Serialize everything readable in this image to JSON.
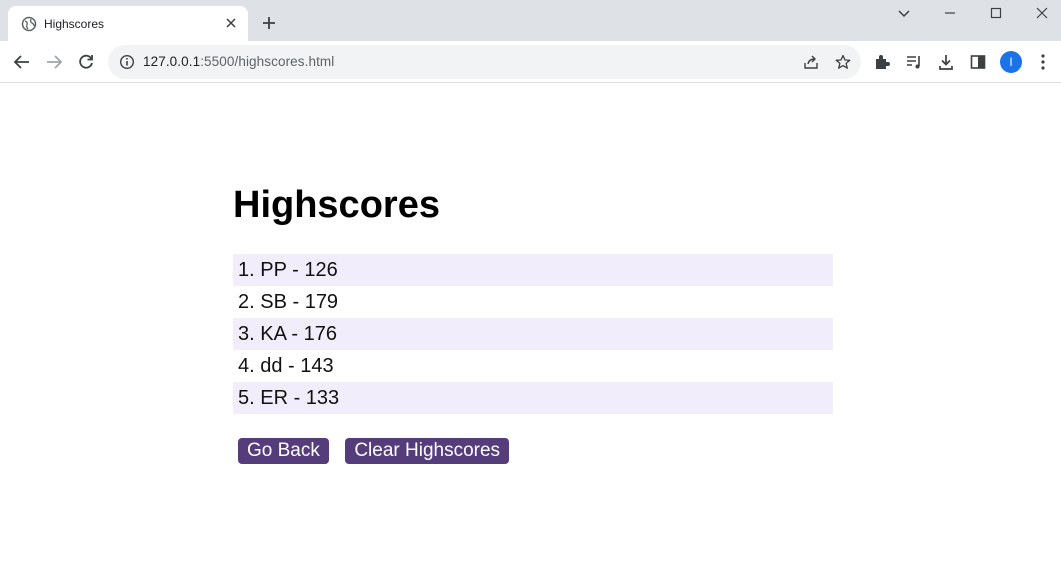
{
  "browser": {
    "tab_title": "Highscores",
    "url_host": "127.0.0.1",
    "url_path": ":5500/highscores.html",
    "avatar_letter": "I"
  },
  "page": {
    "title": "Highscores",
    "scores": [
      "1. PP - 126",
      "2. SB - 179",
      "3. KA - 176",
      "4. dd - 143",
      "5. ER - 133"
    ],
    "go_back_label": "Go Back",
    "clear_label": "Clear Highscores"
  },
  "colors": {
    "button_bg": "#553c7b",
    "row_highlight": "#f2edfa",
    "avatar": "#1a73e8"
  }
}
